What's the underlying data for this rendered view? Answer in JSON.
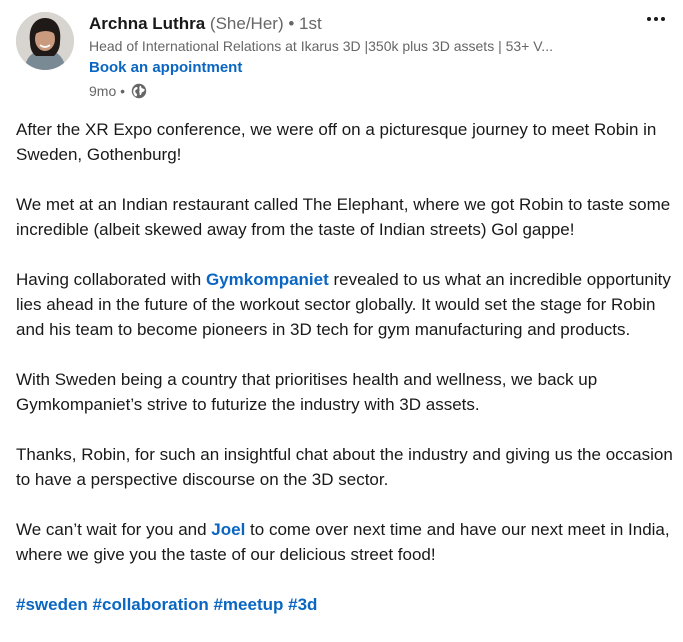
{
  "author": {
    "name": "Archna Luthra",
    "pronouns": "(She/Her)",
    "degree": "• 1st",
    "headline": "Head of International Relations at Ikarus 3D |350k plus 3D assets | 53+ V...",
    "cta": "Book an appointment",
    "time": "9mo •"
  },
  "post": {
    "p1": "After the XR Expo conference, we were off on a picturesque journey to meet Robin in Sweden, Gothenburg!",
    "p2": "We met at an Indian restaurant called The Elephant, where we got Robin to taste some incredible (albeit skewed away from the taste of Indian streets) Gol gappe!",
    "p3_before": "Having collaborated with ",
    "p3_link": "Gymkompaniet",
    "p3_after": " revealed to us what an incredible opportunity lies ahead in the future of the workout sector globally. It would set the stage for Robin and his team to become pioneers in 3D tech for gym manufacturing and products.",
    "p4": "With Sweden being a country that prioritises health and wellness, we back up Gymkompaniet’s strive to futurize the industry with 3D assets.",
    "p5": "Thanks, Robin, for such an insightful chat about the industry and giving us the occasion to have a perspective discourse on the 3D sector.",
    "p6_before": "We can’t wait for you and ",
    "p6_link": "Joel",
    "p6_after": " to come over next time and have our next meet in India, where we give you the taste of our delicious street food!",
    "hashtags": [
      "#sweden",
      "#collaboration",
      "#meetup",
      "#3d"
    ]
  },
  "colors": {
    "link": "#0a66c2",
    "text": "#191919",
    "muted": "#666666"
  },
  "icons": {
    "visibility": "globe-icon",
    "menu": "more-options-icon"
  }
}
